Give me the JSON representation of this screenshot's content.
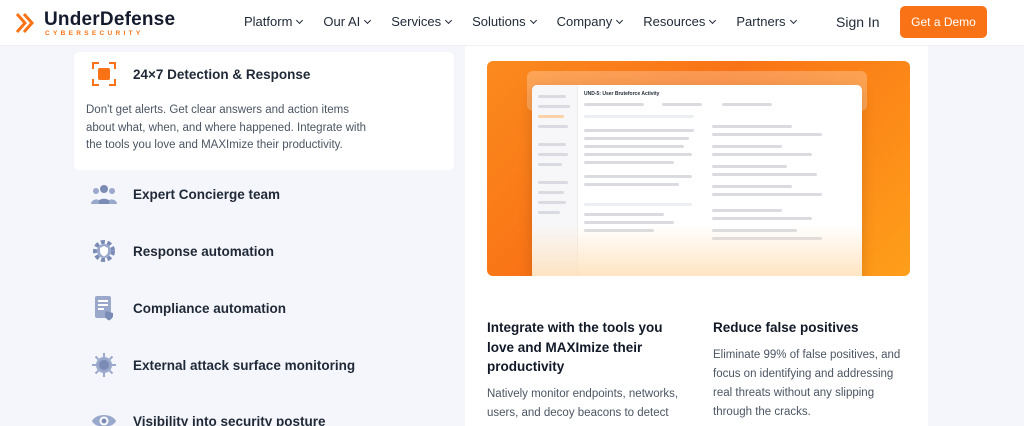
{
  "brand": {
    "name": "UnderDefense",
    "tagline": "CYBERSECURITY",
    "accent": "#f97316"
  },
  "nav": [
    {
      "label": "Platform"
    },
    {
      "label": "Our AI"
    },
    {
      "label": "Services"
    },
    {
      "label": "Solutions"
    },
    {
      "label": "Company"
    },
    {
      "label": "Resources"
    },
    {
      "label": "Partners"
    }
  ],
  "header": {
    "signin": "Sign In",
    "demo": "Get a Demo"
  },
  "features": {
    "active": {
      "title": "24×7 Detection & Response",
      "description": "Don't get alerts. Get clear answers and action items about what, when, and where happened. Integrate with the tools you love and MAXImize their productivity.",
      "icon": "detection-icon"
    },
    "items": [
      {
        "label": "Expert Concierge team",
        "icon": "team-icon"
      },
      {
        "label": "Response automation",
        "icon": "gear-shield-icon"
      },
      {
        "label": "Compliance automation",
        "icon": "compliance-doc-icon"
      },
      {
        "label": "External attack surface monitoring",
        "icon": "virus-icon"
      },
      {
        "label": "Visibility into security posture",
        "icon": "eye-icon"
      }
    ]
  },
  "hero": {
    "screenshot_title": "UND-5: User Bruteforce Activity"
  },
  "columns": [
    {
      "title": "Integrate with the tools you love and MAXImize their productivity",
      "text": "Natively monitor endpoints, networks, users, and decoy beacons to detect"
    },
    {
      "title": "Reduce false positives",
      "text": "Eliminate 99% of false positives, and focus on identifying and addressing real threats without any slipping through the cracks."
    }
  ]
}
